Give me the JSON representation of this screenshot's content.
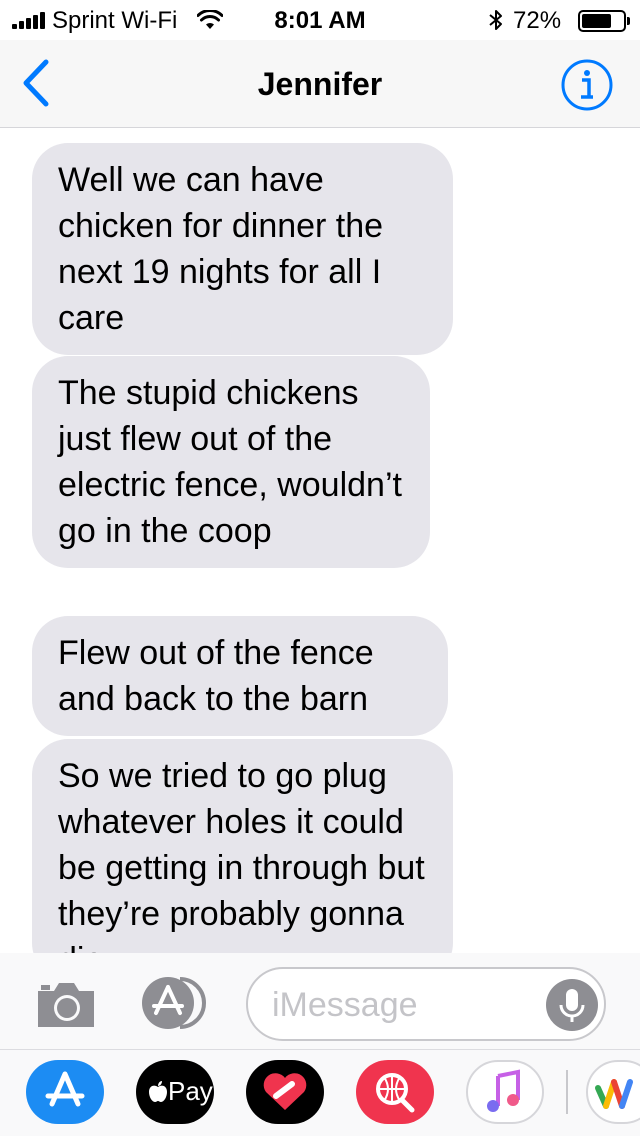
{
  "status_bar": {
    "carrier": "Sprint Wi-Fi",
    "time": "8:01 AM",
    "battery_percent": "72%",
    "battery_level": 0.72
  },
  "nav": {
    "back_icon": "chevron-left-icon",
    "title": "Jennifer",
    "info_icon": "info-icon"
  },
  "messages": [
    {
      "sender": "received",
      "text": "Well we can have chicken for dinner the next 19 nights for all I care"
    },
    {
      "sender": "received",
      "text": "The stupid chickens just flew out of the electric fence, wouldn’t go in the coop"
    },
    {
      "sender": "received",
      "text": "Flew out of the fence and back to the barn"
    },
    {
      "sender": "received",
      "text": "So we tried to go plug whatever holes it could be getting in through but they’re probably gonna die"
    }
  ],
  "input": {
    "placeholder": "iMessage"
  },
  "app_drawer": {
    "apple_pay_label": "Pay",
    "icons": [
      "app-store-icon",
      "apple-pay-icon",
      "digital-touch-icon",
      "image-search-icon",
      "music-icon",
      "google-pay-icon"
    ]
  },
  "colors": {
    "accent": "#007aff",
    "bubble_received": "#e6e5eb",
    "app_store": "#1c8cf3",
    "image_search": "#f0344e"
  }
}
